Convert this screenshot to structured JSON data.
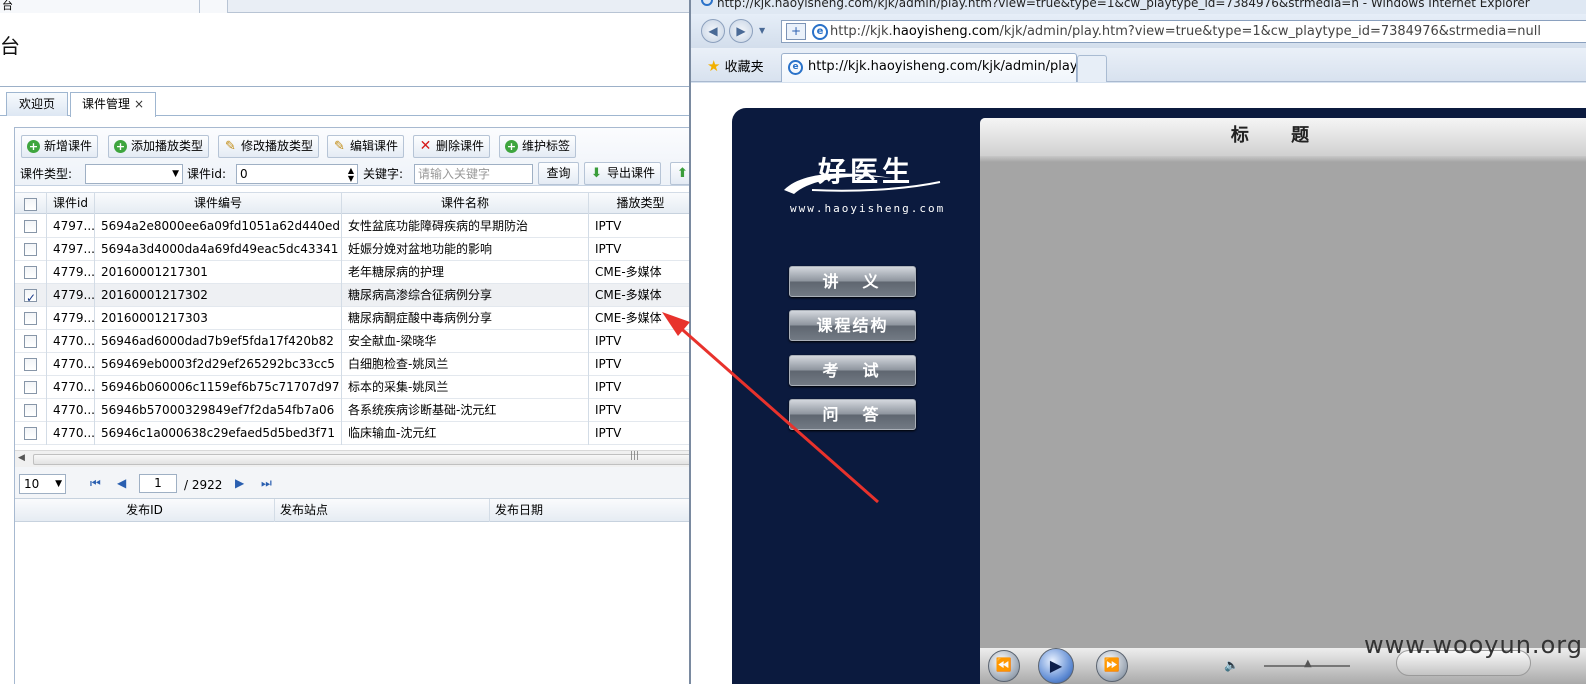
{
  "left_app": {
    "top_tab_text": "台",
    "title": "台",
    "tabs": [
      {
        "label": "欢迎页"
      },
      {
        "label": "课件管理",
        "close": "×"
      }
    ],
    "toolbar": {
      "buttons": [
        {
          "label": "新增课件",
          "icon": "plus-icon"
        },
        {
          "label": "添加播放类型",
          "icon": "plus-icon"
        },
        {
          "label": "修改播放类型",
          "icon": "pencil-icon"
        },
        {
          "label": "编辑课件",
          "icon": "pencil-icon"
        },
        {
          "label": "删除课件",
          "icon": "delete-icon"
        },
        {
          "label": "维护标签",
          "icon": "plus-icon"
        }
      ],
      "filters": {
        "type_label": "课件类型:",
        "type_value": "",
        "id_label": "课件id:",
        "id_value": "0",
        "keyword_label": "关键字:",
        "keyword_placeholder": "请输入关键字",
        "query_button": "查询",
        "export_button": "导出课件"
      }
    },
    "grid": {
      "columns": [
        "课件id",
        "课件编号",
        "课件名称",
        "播放类型"
      ],
      "rows": [
        {
          "id": "4797...",
          "code": "5694a2e8000ee6a09fd1051a62d440ed",
          "name": "女性盆底功能障碍疾病的早期防治",
          "type": "IPTV",
          "checked": false
        },
        {
          "id": "4797...",
          "code": "5694a3d4000da4a69fd49eac5dc43341",
          "name": "妊娠分娩对盆地功能的影响",
          "type": "IPTV",
          "checked": false
        },
        {
          "id": "4779...",
          "code": "20160001217301",
          "name": "老年糖尿病的护理",
          "type": "CME-多媒体",
          "checked": false
        },
        {
          "id": "4779...",
          "code": "20160001217302",
          "name": "糖尿病高渗综合征病例分享",
          "type": "CME-多媒体",
          "checked": true
        },
        {
          "id": "4779...",
          "code": "20160001217303",
          "name": "糖尿病酮症酸中毒病例分享",
          "type": "CME-多媒体",
          "checked": false
        },
        {
          "id": "4770...",
          "code": "56946ad6000dad7b9ef5fda17f420b82",
          "name": "安全献血-梁晓华",
          "type": "IPTV",
          "checked": false
        },
        {
          "id": "4770...",
          "code": "569469eb0003f2d29ef265292bc33cc5",
          "name": "白细胞检查-姚凤兰",
          "type": "IPTV",
          "checked": false
        },
        {
          "id": "4770...",
          "code": "56946b060006c1159ef6b75c71707d97",
          "name": "标本的采集-姚凤兰",
          "type": "IPTV",
          "checked": false
        },
        {
          "id": "4770...",
          "code": "56946b57000329849ef7f2da54fb7a06",
          "name": "各系统疾病诊断基础-沈元红",
          "type": "IPTV",
          "checked": false
        },
        {
          "id": "4770...",
          "code": "56946c1a000638c29efaed5d5bed3f71",
          "name": "临床输血-沈元红",
          "type": "IPTV",
          "checked": false
        }
      ]
    },
    "pager": {
      "page_size": "10",
      "current_page": "1",
      "total": "/ 2922"
    },
    "publish_grid": {
      "columns": [
        "发布ID",
        "发布站点",
        "发布日期"
      ]
    }
  },
  "browser": {
    "window_title": "http://kjk.haoyisheng.com/kjk/admin/play.htm?view=true&type=1&cw_playtype_id=7384976&strmedia=n - Windows Internet Explorer",
    "address_prefix": "http://kjk.",
    "address_domain": "haoyisheng.com",
    "address_suffix": "/kjk/admin/play.htm?view=true&type=1&cw_playtype_id=7384976&strmedia=null",
    "favorites_label": "收藏夹",
    "tab_title": "http://kjk.haoyisheng.com/kjk/admin/play.ht..."
  },
  "player": {
    "logo_zh": "好医生",
    "logo_en": "www.haoyisheng.com",
    "menu": [
      "讲　义",
      "课程结构",
      "考　试",
      "问　答"
    ],
    "screen_title": "标 题"
  },
  "watermark": "www.wooyun.org",
  "colors": {
    "player_bg": "#0b1a3e",
    "annotation_arrow": "#e8322c",
    "tab_border": "#9fb6d0"
  }
}
